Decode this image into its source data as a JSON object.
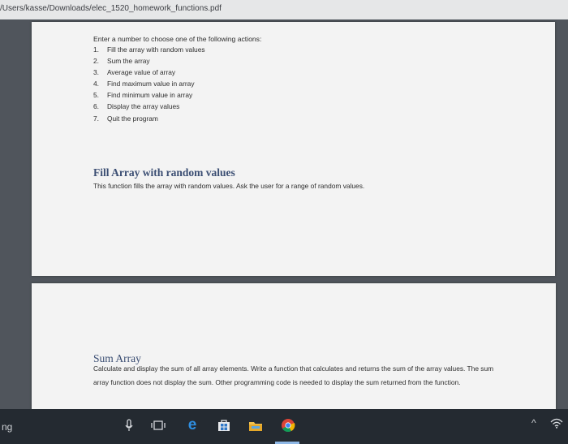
{
  "address_bar": {
    "url": "/Users/kasse/Downloads/elec_1520_homework_functions.pdf"
  },
  "document": {
    "menu_intro": "Enter a number to choose one of the following actions:",
    "menu_items": [
      {
        "num": "1.",
        "text": "Fill the array with random values"
      },
      {
        "num": "2.",
        "text": "Sum the array"
      },
      {
        "num": "3.",
        "text": "Average value of array"
      },
      {
        "num": "4.",
        "text": "Find maximum value in array"
      },
      {
        "num": "5.",
        "text": "Find minimum value in array"
      },
      {
        "num": "6.",
        "text": "Display the array values"
      },
      {
        "num": "7.",
        "text": "Quit the program"
      }
    ],
    "fill_heading": "Fill Array with random values",
    "fill_text": "This function fills the array with random values. Ask the user for a range of random values.",
    "sum_heading": "Sum Array",
    "sum_text": "Calculate and display the sum of all array elements. Write a function that calculates and returns the sum of the array values. The sum array function does not display the sum. Other programming code is needed to display the sum returned from the function."
  },
  "taskbar": {
    "left_text": "ng",
    "icons": [
      "microphone-icon",
      "task-view-icon",
      "edge-icon",
      "store-icon",
      "file-explorer-icon",
      "chrome-icon"
    ],
    "tray": [
      "chevron-up-icon",
      "wifi-icon"
    ],
    "edge_glyph": "e",
    "caret_glyph": "^"
  },
  "colors": {
    "heading": "#3b4e73",
    "taskbar": "#242a31",
    "viewer_bg": "#50555c",
    "page_bg": "#f3f3f3"
  }
}
